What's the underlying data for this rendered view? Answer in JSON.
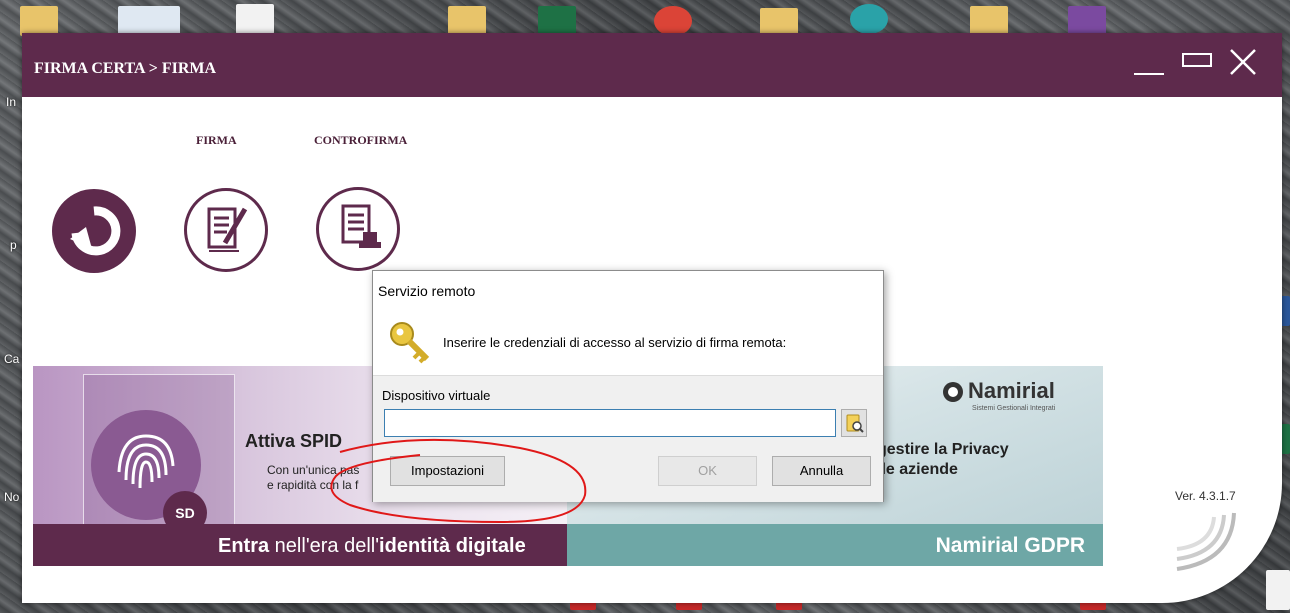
{
  "window": {
    "title": "FIRMA CERTA > FIRMA",
    "version": "Ver. 4.3.1.7"
  },
  "toolbar": {
    "tabs": [
      {
        "label": "FIRMA"
      },
      {
        "label": "CONTROFIRMA"
      }
    ]
  },
  "banners": {
    "spid": {
      "title": "Attiva SPID",
      "subtitle_line1": "Con un'unica pas",
      "subtitle_line2": "e rapidità con la f",
      "footer_part1": "Entra",
      "footer_part2": " nell'era dell'",
      "footer_part3": "identità digitale",
      "badge": "SD"
    },
    "gdpr": {
      "brand": "Namirial",
      "brand_sub": "Sistemi Gestionali Integrati",
      "text_line1": "gestire la Privacy",
      "text_line2": "lle aziende",
      "footer": "Namirial GDPR"
    }
  },
  "dialog": {
    "title": "Servizio remoto",
    "message": "Inserire le credenziali di accesso al servizio di firma remota:",
    "field_label": "Dispositivo virtuale",
    "field_value": "",
    "settings_label": "Impostazioni",
    "ok_label": "OK",
    "cancel_label": "Annulla"
  },
  "desktop": {
    "labels": [
      "In",
      "p",
      "Ca",
      "No"
    ]
  },
  "colors": {
    "brand_purple": "#5e2a4c",
    "gdpr_teal": "#6ea7a6",
    "annotation_red": "#e01818"
  }
}
